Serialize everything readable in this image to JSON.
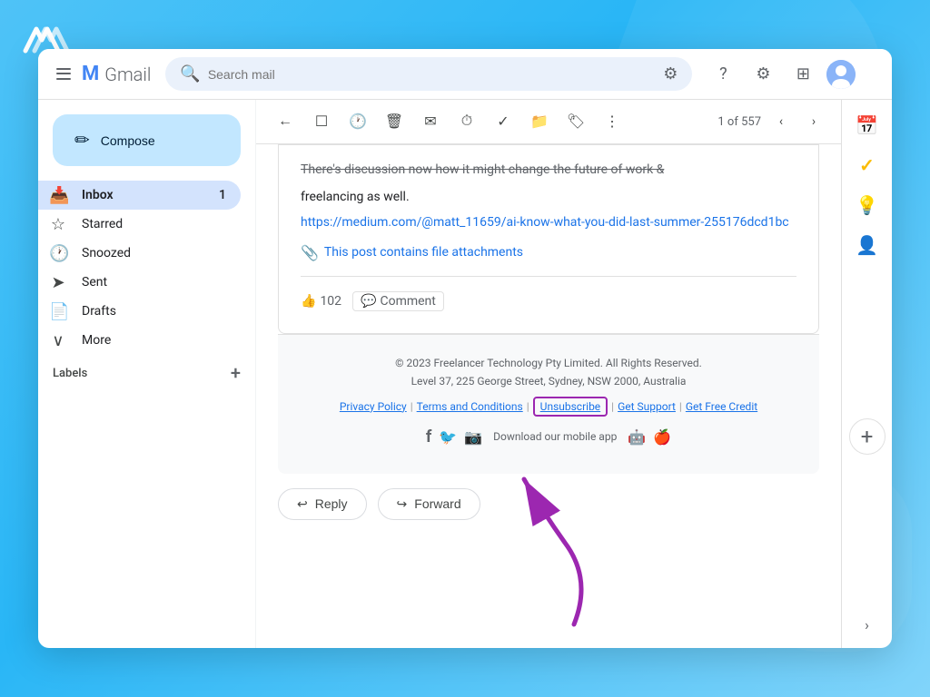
{
  "logo": {
    "alt": "Freelancer logo"
  },
  "header": {
    "menu_icon_alt": "Main menu",
    "gmail_label": "Gmail",
    "search_placeholder": "Search mail",
    "help_icon": "?",
    "settings_icon": "⚙",
    "apps_icon": "⊞",
    "avatar_initials": "U"
  },
  "sidebar": {
    "compose_label": "Compose",
    "nav_items": [
      {
        "id": "inbox",
        "icon": "📥",
        "label": "Inbox",
        "badge": "1",
        "active": true
      },
      {
        "id": "starred",
        "icon": "☆",
        "label": "Starred",
        "badge": "",
        "active": false
      },
      {
        "id": "snoozed",
        "icon": "🕐",
        "label": "Snoozed",
        "badge": "",
        "active": false
      },
      {
        "id": "sent",
        "icon": "➤",
        "label": "Sent",
        "badge": "",
        "active": false
      },
      {
        "id": "drafts",
        "icon": "📄",
        "label": "Drafts",
        "badge": "",
        "active": false
      },
      {
        "id": "more",
        "icon": "∨",
        "label": "More",
        "badge": "",
        "active": false
      }
    ],
    "labels_title": "Labels",
    "labels_plus": "+"
  },
  "toolbar": {
    "back_icon": "←",
    "archive_icon": "□→",
    "snooze_icon": "🕐",
    "delete_icon": "🗑",
    "email_icon": "✉",
    "more1_icon": "⏱",
    "check_icon": "✓",
    "move_icon": "📁",
    "label_icon": "🏷",
    "more2_icon": "⋮",
    "email_count": "1 of 557",
    "prev_icon": "‹",
    "next_icon": "›"
  },
  "email": {
    "body_text_strikethrough": "There's discussion now how it might change the future of work &",
    "body_text": "freelancing as well.",
    "link_url": "https://medium.com/@matt_11659/ai-know-what-you-did-last-summer-255176dcd1bc",
    "link_text": "https://medium.com/@matt_11659/ai-know-what-you-did-last-summer-255176dcd1bc",
    "attachment_text": "This post contains file attachments",
    "likes_count": "102",
    "comment_label": "Comment"
  },
  "footer": {
    "copyright": "© 2023 Freelancer Technology Pty Limited. All Rights Reserved.",
    "address": "Level 37, 225 George Street, Sydney, NSW 2000, Australia",
    "links": [
      {
        "label": "Privacy Policy",
        "highlighted": false
      },
      {
        "label": "Terms and Conditions",
        "highlighted": false
      },
      {
        "label": "Unsubscribe",
        "highlighted": true
      },
      {
        "label": "Get Support",
        "highlighted": false
      },
      {
        "label": "Get Free Credit",
        "highlighted": false
      }
    ],
    "social_icons": [
      "f",
      "🐦",
      "📷"
    ],
    "app_text": "Download our mobile app",
    "android_icon": "🤖",
    "apple_icon": "🍎"
  },
  "actions": {
    "reply_label": "Reply",
    "forward_label": "Forward"
  },
  "right_sidebar": {
    "icons": [
      {
        "id": "calendar",
        "symbol": "📅",
        "dot_color": "#1a73e8"
      },
      {
        "id": "tasks",
        "symbol": "✓",
        "dot_color": "#fbbc05"
      },
      {
        "id": "keep",
        "symbol": "💡",
        "dot_color": "#34a853"
      },
      {
        "id": "contacts",
        "symbol": "👤",
        "dot_color": "#ea4335"
      }
    ],
    "plus_label": "+"
  }
}
